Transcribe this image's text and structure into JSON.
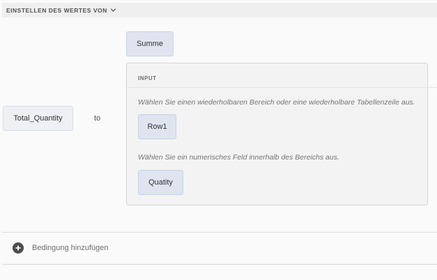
{
  "header": {
    "title": "EINSTELLEN DES WERTES VON",
    "toggle_icon": "chevron-down-icon"
  },
  "rule": {
    "target_field": "Total_Quantity",
    "connector": "to",
    "function_name": "Summe"
  },
  "input_panel": {
    "title": "INPUT",
    "repeatable_hint": "Wählen Sie einen wiederholbaren Bereich oder eine wiederholbare Tabellenzeile aus.",
    "repeatable_value": "Row1",
    "numeric_hint": "Wählen Sie ein numerisches Feld innerhalb des Bereichs aus.",
    "numeric_value": "Quatity"
  },
  "footer": {
    "add_condition_label": "Bedingung hinzufügen",
    "add_icon": "plus-circle-icon"
  },
  "colors": {
    "token_bg": "#dfe4ef",
    "panel_bg": "#f3f3f3",
    "icon": "#4b4b4b"
  }
}
